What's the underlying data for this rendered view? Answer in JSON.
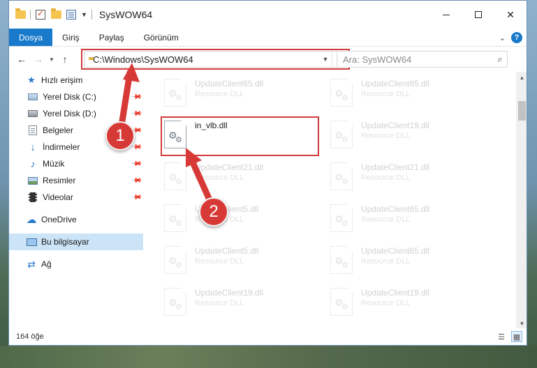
{
  "window": {
    "title": "SysWOW64"
  },
  "ribbon": {
    "tabs": [
      "Dosya",
      "Giriş",
      "Paylaş",
      "Görünüm"
    ],
    "help": "?"
  },
  "nav": {
    "address": "C:\\Windows\\SysWOW64",
    "search_placeholder": "Ara: SysWOW64"
  },
  "sidebar": {
    "items": [
      {
        "label": "Hızlı erişim",
        "icon": "star-icon"
      },
      {
        "label": "Yerel Disk (C:)",
        "icon": "drive-icon",
        "pinned": true
      },
      {
        "label": "Yerel Disk (D:)",
        "icon": "drive-icon",
        "pinned": true
      },
      {
        "label": "Belgeler",
        "icon": "documents-icon",
        "pinned": true
      },
      {
        "label": "İndirmeler",
        "icon": "download-icon",
        "pinned": true
      },
      {
        "label": "Müzik",
        "icon": "music-icon",
        "pinned": true
      },
      {
        "label": "Resimler",
        "icon": "pictures-icon",
        "pinned": true
      },
      {
        "label": "Videolar",
        "icon": "videos-icon",
        "pinned": true
      },
      {
        "label": "OneDrive",
        "icon": "cloud-icon"
      },
      {
        "label": "Bu bilgisayar",
        "icon": "computer-icon",
        "selected": true
      },
      {
        "label": "Ağ",
        "icon": "network-icon"
      }
    ]
  },
  "files": {
    "highlighted": {
      "name": "in_vlb.dll"
    },
    "ghost_left": [
      {
        "name": "UpdateClient65.dll",
        "type": "Resource DLL"
      },
      {
        "name": "UpdateClient21.dll",
        "type": "Resource DLL"
      },
      {
        "name": "UpdateClient5.dll",
        "type": "Resource DLL"
      },
      {
        "name": "UpdateClient5.dll",
        "type": "Resource DLL"
      },
      {
        "name": "UpdateClient19.dll",
        "type": "Resource DLL"
      }
    ],
    "ghost_right": [
      {
        "name": "UpdateClient65.dll",
        "type": "Resource DLL"
      },
      {
        "name": "UpdateClient19.dll",
        "type": "Resource DLL"
      },
      {
        "name": "UpdateClient21.dll",
        "type": "Resource DLL"
      },
      {
        "name": "UpdateClient65.dll",
        "type": "Resource DLL"
      },
      {
        "name": "UpdateClient65.dll",
        "type": "Resource DLL"
      },
      {
        "name": "UpdateClient19.dll",
        "type": "Resource DLL"
      }
    ]
  },
  "status": {
    "count": "164 öğe"
  },
  "annotations": {
    "step1": "1",
    "step2": "2",
    "color": "#d73a36"
  }
}
